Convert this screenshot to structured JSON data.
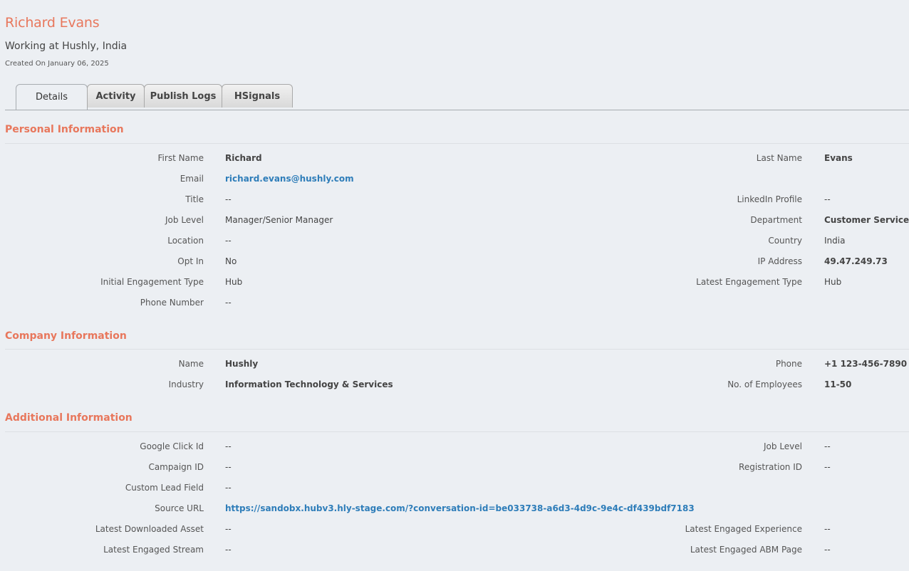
{
  "header": {
    "name": "Richard Evans",
    "subtitle": "Working at Hushly, India",
    "created": "Created On January 06, 2025"
  },
  "tabs": [
    {
      "label": "Details",
      "active": true
    },
    {
      "label": "Activity",
      "active": false
    },
    {
      "label": "Publish Logs",
      "active": false
    },
    {
      "label": "HSignals",
      "active": false
    }
  ],
  "personal": {
    "title": "Personal Information",
    "first_name": {
      "label": "First Name",
      "value": "Richard"
    },
    "last_name": {
      "label": "Last Name",
      "value": "Evans"
    },
    "email": {
      "label": "Email",
      "value": "richard.evans@hushly.com"
    },
    "job_title": {
      "label": "Title",
      "value": "--"
    },
    "linkedin": {
      "label": "LinkedIn Profile",
      "value": "--"
    },
    "job_level": {
      "label": "Job Level",
      "value": "Manager/Senior Manager"
    },
    "department": {
      "label": "Department",
      "value": "Customer Service"
    },
    "location": {
      "label": "Location",
      "value": "--"
    },
    "country": {
      "label": "Country",
      "value": "India"
    },
    "opt_in": {
      "label": "Opt In",
      "value": "No"
    },
    "ip_address": {
      "label": "IP Address",
      "value": "49.47.249.73"
    },
    "initial_engagement": {
      "label": "Initial Engagement Type",
      "value": "Hub"
    },
    "latest_engagement": {
      "label": "Latest Engagement Type",
      "value": "Hub"
    },
    "phone_number": {
      "label": "Phone Number",
      "value": "--"
    }
  },
  "company": {
    "title": "Company Information",
    "name": {
      "label": "Name",
      "value": "Hushly"
    },
    "phone": {
      "label": "Phone",
      "value": "+1 123-456-7890"
    },
    "industry": {
      "label": "Industry",
      "value": "Information Technology & Services"
    },
    "employees": {
      "label": "No. of Employees",
      "value": "11-50"
    }
  },
  "additional": {
    "title": "Additional Information",
    "google_click_id": {
      "label": "Google Click Id",
      "value": "--"
    },
    "job_level": {
      "label": "Job Level",
      "value": "--"
    },
    "campaign_id": {
      "label": "Campaign ID",
      "value": "--"
    },
    "registration_id": {
      "label": "Registration ID",
      "value": "--"
    },
    "custom_lead_field": {
      "label": "Custom Lead Field",
      "value": "--"
    },
    "source_url": {
      "label": "Source URL",
      "value": "https://sandobx.hubv3.hly-stage.com/?conversation-id=be033738-a6d3-4d9c-9e4c-df439bdf7183"
    },
    "latest_downloaded_asset": {
      "label": "Latest Downloaded Asset",
      "value": "--"
    },
    "latest_engaged_experience": {
      "label": "Latest Engaged Experience",
      "value": "--"
    },
    "latest_engaged_stream": {
      "label": "Latest Engaged Stream",
      "value": "--"
    },
    "latest_engaged_abm_page": {
      "label": "Latest Engaged ABM Page",
      "value": "--"
    }
  },
  "colors": {
    "accent": "#e8775c",
    "link": "#2e7db9",
    "background": "#eceff3"
  }
}
